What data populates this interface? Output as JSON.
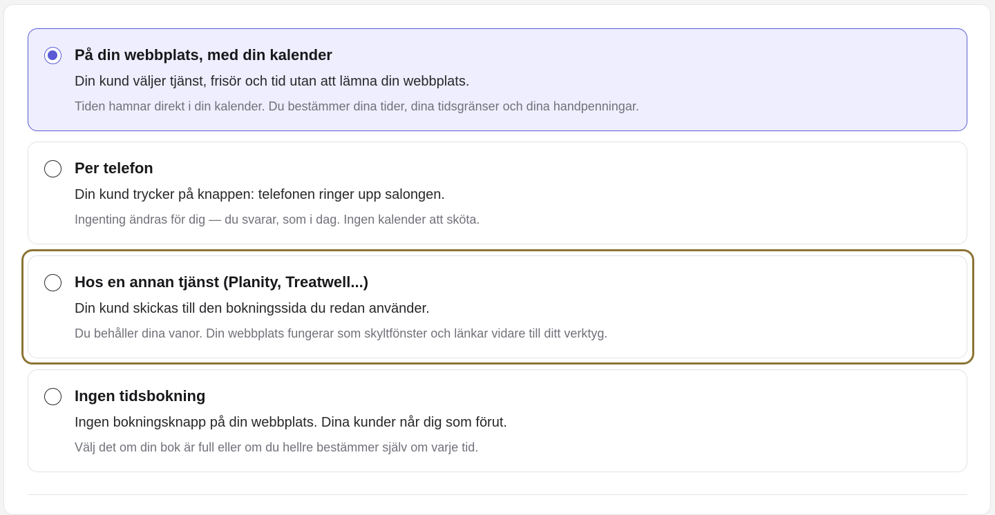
{
  "booking_options": [
    {
      "title": "På din webbplats, med din kalender",
      "description": "Din kund väljer tjänst, frisör och tid utan att lämna din webbplats.",
      "note": "Tiden hamnar direkt i din kalender. Du bestämmer dina tider, dina tidsgränser och dina handpenningar.",
      "selected": true
    },
    {
      "title": "Per telefon",
      "description": "Din kund trycker på knappen: telefonen ringer upp salongen.",
      "note": "Ingenting ändras för dig — du svarar, som i dag. Ingen kalender att sköta.",
      "selected": false
    },
    {
      "title": "Hos en annan tjänst (Planity, Treatwell...)",
      "description": "Din kund skickas till den bokningssida du redan använder.",
      "note": "Du behåller dina vanor. Din webbplats fungerar som skyltfönster och länkar vidare till ditt verktyg.",
      "selected": false,
      "focused": true
    },
    {
      "title": "Ingen tidsbokning",
      "description": "Ingen bokningsknapp på din webbplats. Dina kunder når dig som förut.",
      "note": "Välj det om din bok är full eller om du hellre bestämmer själv om varje tid.",
      "selected": false
    }
  ],
  "colors": {
    "accent": "#5b5bd6",
    "selected_background": "#eeeefe",
    "focus_ring": "#8c7434"
  },
  "icons": {
    "radio_checked": "radio-checked-icon",
    "radio_unchecked": "radio-unchecked-icon"
  }
}
